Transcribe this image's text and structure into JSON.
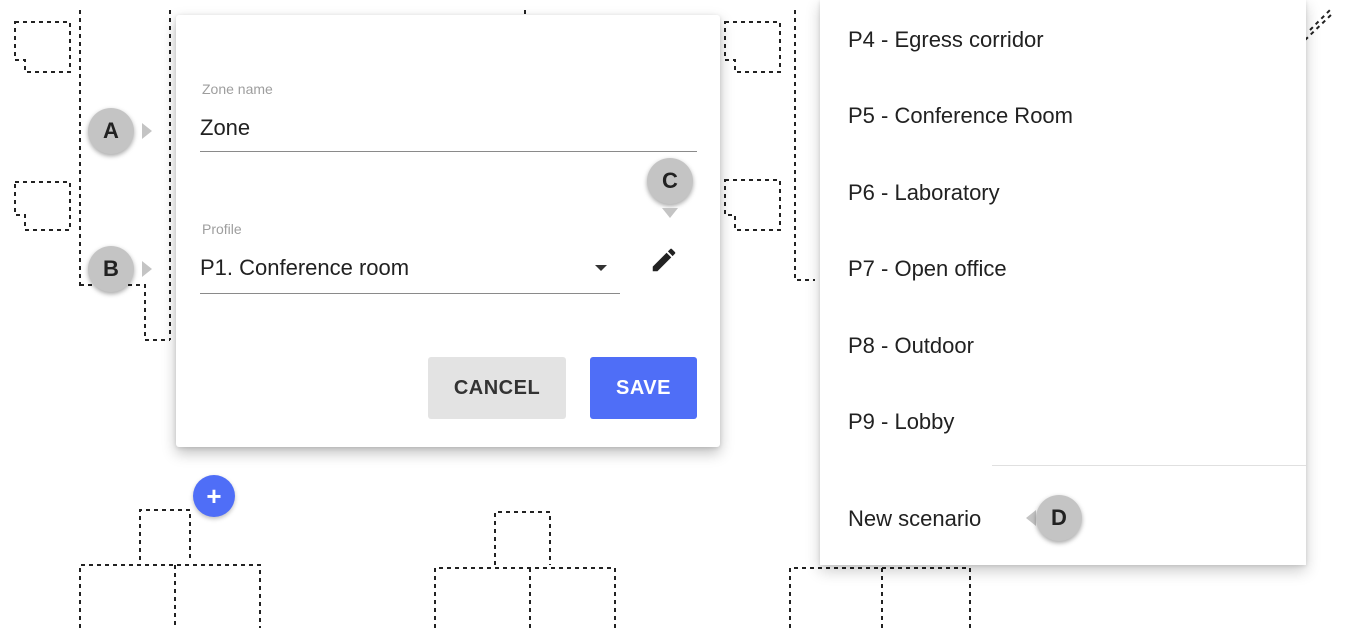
{
  "dialog": {
    "zone_name_label": "Zone name",
    "zone_name_value": "Zone",
    "profile_label": "Profile",
    "profile_value": "P1. Conference room",
    "cancel_label": "CANCEL",
    "save_label": "SAVE",
    "edit_icon": "pencil-icon"
  },
  "add_button": {
    "label": "+",
    "icon": "plus-icon"
  },
  "markers": {
    "a": "A",
    "b": "B",
    "c": "C",
    "d": "D"
  },
  "profile_menu": {
    "items": [
      "P4 - Egress corridor",
      "P5 - Conference Room",
      "P6 - Laboratory",
      "P7 - Open office",
      "P8 - Outdoor",
      "P9 - Lobby"
    ],
    "new_scenario": "New scenario"
  },
  "colors": {
    "primary": "#4f6ef7",
    "marker": "#c4c4c4",
    "cancel_bg": "#e3e3e3"
  }
}
